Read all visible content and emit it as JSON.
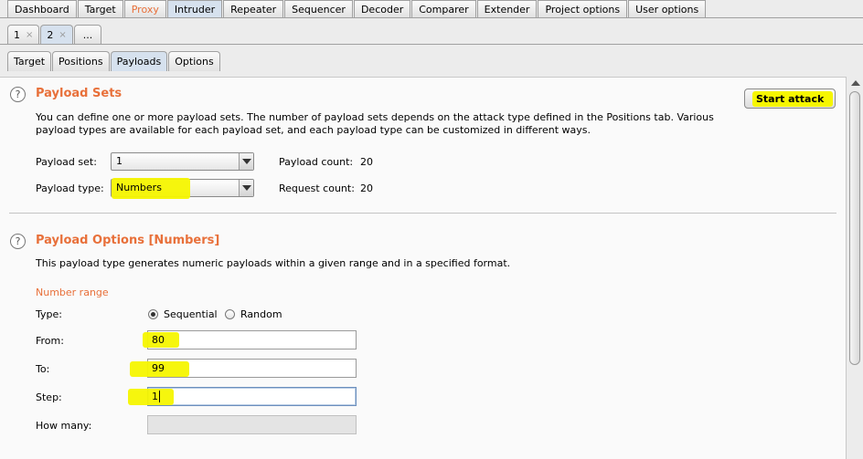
{
  "main_tabs": [
    "Dashboard",
    "Target",
    "Proxy",
    "Intruder",
    "Repeater",
    "Sequencer",
    "Decoder",
    "Comparer",
    "Extender",
    "Project options",
    "User options"
  ],
  "sub_tabs": [
    {
      "label": "1",
      "close": "×"
    },
    {
      "label": "2",
      "close": "×"
    },
    {
      "label": "..."
    }
  ],
  "intruder_tabs": [
    "Target",
    "Positions",
    "Payloads",
    "Options"
  ],
  "payload_sets": {
    "title": "Payload Sets",
    "description_line1": "You can define one or more payload sets. The number of payload sets depends on the attack type defined in the Positions tab. Various",
    "description_line2": "payload types are available for each payload set, and each payload type can be customized in different ways.",
    "payload_set_label": "Payload set:",
    "payload_set_value": "1",
    "payload_count_label": "Payload count:",
    "payload_count_value": "20",
    "payload_type_label": "Payload type:",
    "payload_type_value": "Numbers",
    "request_count_label": "Request count:",
    "request_count_value": "20",
    "start_attack": "Start attack"
  },
  "payload_options": {
    "title": "Payload Options [Numbers]",
    "description": "This payload type generates numeric payloads within a given range and in a specified format.",
    "number_range_label": "Number range",
    "type_label": "Type:",
    "type_options": [
      "Sequential",
      "Random"
    ],
    "type_selected": "Sequential",
    "from_label": "From:",
    "from_value": "80",
    "to_label": "To:",
    "to_value": "99",
    "step_label": "Step:",
    "step_value": "1",
    "how_many_label": "How many:",
    "how_many_value": ""
  },
  "help_icon_glyph": "?",
  "colors": {
    "accent": "#e8703a",
    "highlight": "#f6f600",
    "active_tab": "#d6e1ee"
  }
}
